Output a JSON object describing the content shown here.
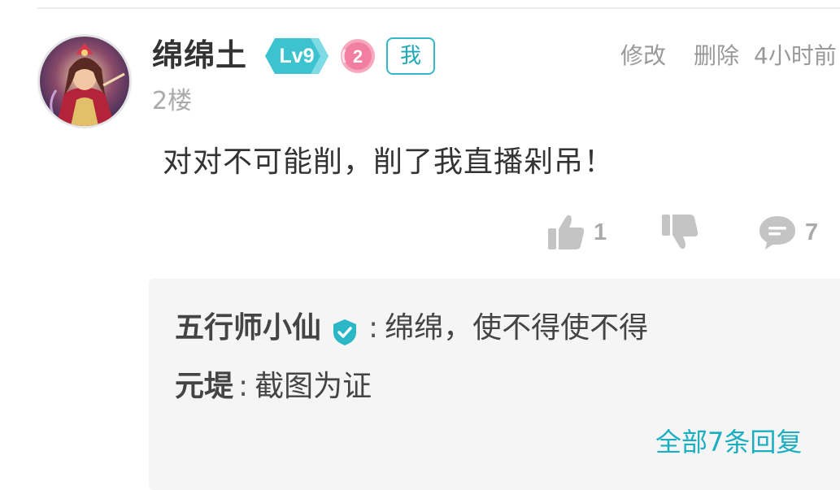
{
  "comment": {
    "username": "绵绵土",
    "level": "Lv9",
    "medal_number": "2",
    "me_label": "我",
    "edit_label": "修改",
    "delete_label": "删除",
    "time": "4小时前",
    "floor": "2楼",
    "text": "对对不可能削，削了我直播剁吊！",
    "likes": "1",
    "replies_count": "7"
  },
  "replies": {
    "items": [
      {
        "name": "五行师小仙",
        "verified": true,
        "colon": ":",
        "text": "绵绵，使不得使不得"
      },
      {
        "name": "元堤",
        "verified": false,
        "colon": ":",
        "text": "截图为证"
      }
    ],
    "view_all_label": "全部7条回复"
  },
  "colors": {
    "accent": "#1aaec0",
    "level_badge": "#3cc3cf",
    "medal": "#f59bb5",
    "muted_text": "#999999",
    "reply_background": "#f5f5f5"
  },
  "icons": {
    "like": "thumbs-up-icon",
    "dislike": "thumbs-down-icon",
    "reply": "speech-bubble-icon",
    "verified": "verified-check-icon"
  }
}
